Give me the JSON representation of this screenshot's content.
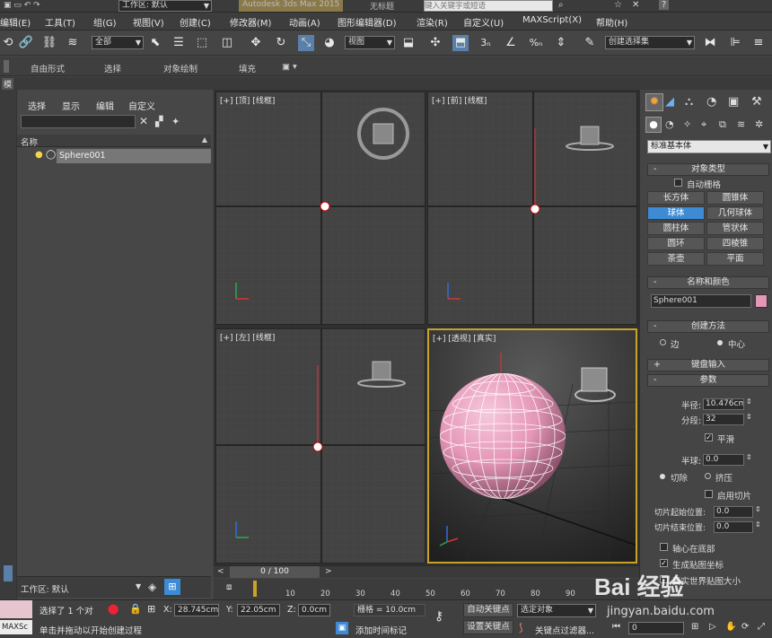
{
  "titlebar": {
    "workspace_label": "工作区: 默认",
    "app_title": "Autodesk 3ds Max 2015",
    "file_title": "无标题",
    "search_placeholder": "键入关键字或短语"
  },
  "menubar": {
    "items": [
      "编辑(E)",
      "工具(T)",
      "组(G)",
      "视图(V)",
      "创建(C)",
      "修改器(M)",
      "动画(A)",
      "图形编辑器(D)",
      "渲染(R)",
      "自定义(U)",
      "MAXScript(X)",
      "帮助(H)"
    ]
  },
  "toolbar": {
    "selection_filter": "全部",
    "ref_coord": "视图",
    "named_selection": "创建选择集",
    "snap_3": "3",
    "snap_pct": "%"
  },
  "ribbon": {
    "tabs": [
      "自由形式",
      "选择",
      "对象绘制",
      "填充"
    ]
  },
  "strip": {
    "label": "模"
  },
  "scene_explorer": {
    "menus": [
      "选择",
      "显示",
      "编辑",
      "自定义"
    ],
    "column_header": "名称",
    "items": [
      "Sphere001"
    ],
    "workspace": "工作区: 默认"
  },
  "viewports": {
    "top": "[+] [顶] [线框]",
    "front": "[+] [前] [线框]",
    "left": "[+] [左] [线框]",
    "perspective": "[+] [透视] [真实]"
  },
  "command_panel": {
    "category": "标准基本体",
    "object_type_title": "对象类型",
    "auto_grid": "自动栅格",
    "object_buttons": [
      "长方体",
      "圆锥体",
      "球体",
      "几何球体",
      "圆柱体",
      "管状体",
      "圆环",
      "四棱锥",
      "茶壶",
      "平面"
    ],
    "selected_object_button": "球体",
    "name_color_title": "名称和颜色",
    "object_name": "Sphere001",
    "object_color": "#e597b8",
    "creation_method_title": "创建方法",
    "creation_methods": [
      "边",
      "中心"
    ],
    "selected_creation_method": "中心",
    "keyboard_entry_title": "键盘输入",
    "params_title": "参数",
    "radius_label": "半径:",
    "radius_value": "10.476cm",
    "segments_label": "分段:",
    "segments_value": "32",
    "smooth_label": "平滑",
    "smooth_checked": true,
    "hemisphere_label": "半球:",
    "hemisphere_value": "0.0",
    "chop_label": "切除",
    "squash_label": "挤压",
    "slice_on_label": "启用切片",
    "slice_from_label": "切片起始位置:",
    "slice_from_value": "0.0",
    "slice_to_label": "切片结束位置:",
    "slice_to_value": "0.0",
    "base_to_pivot_label": "轴心在底部",
    "gen_mapping_label": "生成贴图坐标",
    "real_world_label": "真实世界贴图大小"
  },
  "timeline": {
    "frame_display": "0 / 100",
    "ticks": [
      "10",
      "20",
      "30",
      "40",
      "50",
      "60",
      "70",
      "80",
      "90"
    ]
  },
  "status": {
    "selection_info": "选择了 1 个对",
    "prompt": "单击并拖动以开始创建过程",
    "x_label": "X:",
    "x_value": "28.745cm",
    "y_label": "Y:",
    "y_value": "22.05cm",
    "z_label": "Z:",
    "z_value": "0.0cm",
    "grid_label": "栅格 = 10.0cm",
    "add_time_tag": "添加时间标记",
    "auto_key": "自动关键点",
    "set_key": "设置关键点",
    "key_filter_dropdown": "选定对象",
    "key_filters": "关键点过滤器...",
    "maxscript_label": "MAXSc",
    "frame_field": "0"
  },
  "watermark": {
    "brand": "Bai 经验",
    "url": "jingyan.baidu.com"
  },
  "colors": {
    "selection_blue": "#3d8bd5",
    "sphere_pink": "#e597b8",
    "active_viewport_border": "#c9a227"
  }
}
